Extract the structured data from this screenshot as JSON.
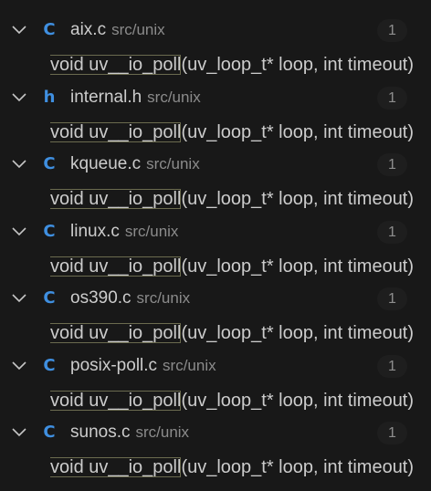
{
  "files": [
    {
      "type_icon": "C",
      "type_icon_name": "c-file-icon",
      "name": "aix.c",
      "path": "src/unix",
      "count": "1",
      "match": {
        "highlight": "void uv__io_poll",
        "rest": "(uv_loop_t* loop, int timeout)"
      }
    },
    {
      "type_icon": "h",
      "type_icon_name": "header-file-icon",
      "name": "internal.h",
      "path": "src/unix",
      "count": "1",
      "match": {
        "highlight": "void uv__io_poll",
        "rest": "(uv_loop_t* loop, int timeout)"
      }
    },
    {
      "type_icon": "C",
      "type_icon_name": "c-file-icon",
      "name": "kqueue.c",
      "path": "src/unix",
      "count": "1",
      "match": {
        "highlight": "void uv__io_poll",
        "rest": "(uv_loop_t* loop, int timeout)"
      }
    },
    {
      "type_icon": "C",
      "type_icon_name": "c-file-icon",
      "name": "linux.c",
      "path": "src/unix",
      "count": "1",
      "match": {
        "highlight": "void uv__io_poll",
        "rest": "(uv_loop_t* loop, int timeout)"
      }
    },
    {
      "type_icon": "C",
      "type_icon_name": "c-file-icon",
      "name": "os390.c",
      "path": "src/unix",
      "count": "1",
      "match": {
        "highlight": "void uv__io_poll",
        "rest": "(uv_loop_t* loop, int timeout)"
      }
    },
    {
      "type_icon": "C",
      "type_icon_name": "c-file-icon",
      "name": "posix-poll.c",
      "path": "src/unix",
      "count": "1",
      "match": {
        "highlight": "void uv__io_poll",
        "rest": "(uv_loop_t* loop, int timeout)"
      }
    },
    {
      "type_icon": "C",
      "type_icon_name": "c-file-icon",
      "name": "sunos.c",
      "path": "src/unix",
      "count": "1",
      "match": {
        "highlight": "void uv__io_poll",
        "rest": "(uv_loop_t* loop, int timeout)"
      }
    }
  ],
  "colors": {
    "background": "#181818",
    "file_icon": "#3f8fe0",
    "text": "#cccccc",
    "path_text": "#8b8b8b",
    "match_outline": "#6b6b4f"
  }
}
